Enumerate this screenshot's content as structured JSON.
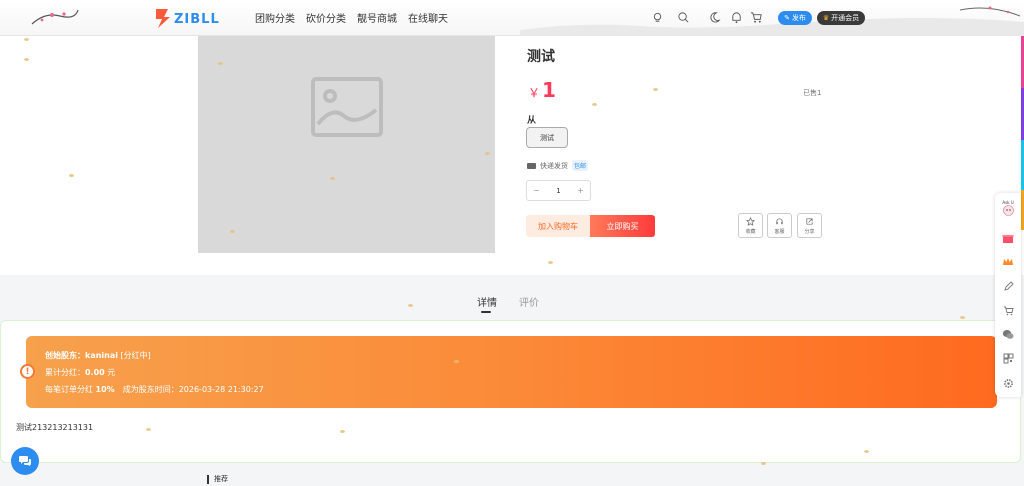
{
  "header": {
    "nav": [
      "团购分类",
      "砍价分类",
      "靓号商城",
      "在线聊天"
    ],
    "icons": [
      "bulb-icon",
      "search-icon",
      "moon-icon",
      "bell-icon",
      "cart-icon"
    ],
    "publish_label": "发布",
    "vip_label": "开通会员",
    "accent_color": "#2d8cf0"
  },
  "product": {
    "title": "测试",
    "currency": "￥",
    "price": "1",
    "sold": "已售1",
    "spec_label": "从",
    "spec_option": "测试",
    "shipping": "快递发货",
    "shipping_tag": "包邮",
    "qty_minus": "−",
    "qty_value": "1",
    "qty_plus": "+",
    "add_to_cart": "加入购物车",
    "buy_now": "立即购买",
    "actions": {
      "favorite": "收藏",
      "service": "客服",
      "share": "分享"
    }
  },
  "tabs": {
    "detail": "详情",
    "review": "评价"
  },
  "banner": {
    "line1_label": "创始股东：",
    "line1_value": "kaninai",
    "line1_suffix": " [分红中]",
    "line2_label": "累计分红：",
    "line2_value": "0.00",
    "line2_suffix": " 元",
    "line3_label": "每笔订单分红 ",
    "line3_value": "10%",
    "line3_suffix": "　成为股东时间：2026-03-28 21:30:27",
    "alert": "!"
  },
  "detail_text": "测试213213213131",
  "recommend_label": "推荐",
  "float_bar": {
    "avatar_label": "Ask U"
  }
}
